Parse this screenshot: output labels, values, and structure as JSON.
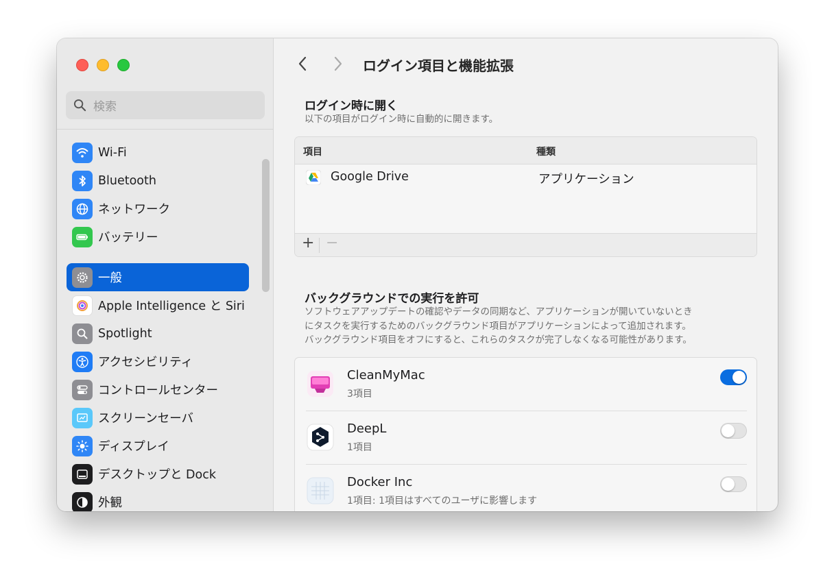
{
  "window": {
    "title": "ログイン項目と機能拡張",
    "accent_color": "#0a64d8"
  },
  "search": {
    "placeholder": "検索"
  },
  "sidebar": {
    "items": [
      {
        "label": "Wi-Fi",
        "icon": "wifi-icon",
        "color": "#2f86f6"
      },
      {
        "label": "Bluetooth",
        "icon": "bluetooth-icon",
        "color": "#2f86f6"
      },
      {
        "label": "ネットワーク",
        "icon": "globe-icon",
        "color": "#2f86f6"
      },
      {
        "label": "バッテリー",
        "icon": "battery-icon",
        "color": "#33c74e"
      },
      {
        "label": "一般",
        "icon": "gear-icon",
        "color": "#8e8e93",
        "selected": true
      },
      {
        "label": "Apple Intelligence と Siri",
        "icon": "siri-icon",
        "color": "#ffffff"
      },
      {
        "label": "Spotlight",
        "icon": "spotlight-icon",
        "color": "#8e8e93"
      },
      {
        "label": "アクセシビリティ",
        "icon": "accessibility-icon",
        "color": "#1f7cf5"
      },
      {
        "label": "コントロールセンター",
        "icon": "toggles-icon",
        "color": "#8e8e93"
      },
      {
        "label": "スクリーンセーバ",
        "icon": "screensaver-icon",
        "color": "#5ac8fa"
      },
      {
        "label": "ディスプレイ",
        "icon": "sun-icon",
        "color": "#2f86f6"
      },
      {
        "label": "デスクトップと Dock",
        "icon": "dock-icon",
        "color": "#1d1d1f"
      },
      {
        "label": "外観",
        "icon": "appearance-icon",
        "color": "#1d1d1f"
      }
    ]
  },
  "login_section": {
    "title": "ログイン時に開く",
    "description": "以下の項目がログイン時に自動的に開きます。",
    "columns": [
      "項目",
      "種類"
    ],
    "rows": [
      {
        "name": "Google Drive",
        "kind": "アプリケーション",
        "icon": "google-drive-icon"
      }
    ],
    "add_label": "+",
    "remove_label": "−"
  },
  "background_section": {
    "title": "バックグラウンドでの実行を許可",
    "description_lines": [
      "ソフトウェアアップデートの確認やデータの同期など、アプリケーションが開いていないとき",
      "にタスクを実行するためのバックグラウンド項目がアプリケーションによって追加されます。",
      "バックグラウンド項目をオフにすると、これらのタスクが完了しなくなる可能性があります。"
    ],
    "items": [
      {
        "name": "CleanMyMac",
        "detail": "3項目",
        "enabled": true,
        "icon": "cleanmymac-icon"
      },
      {
        "name": "DeepL",
        "detail": "1項目",
        "enabled": false,
        "icon": "deepl-icon"
      },
      {
        "name": "Docker Inc",
        "detail": "1項目: 1項目はすべてのユーザに影響します",
        "enabled": false,
        "icon": "docker-icon"
      }
    ]
  }
}
